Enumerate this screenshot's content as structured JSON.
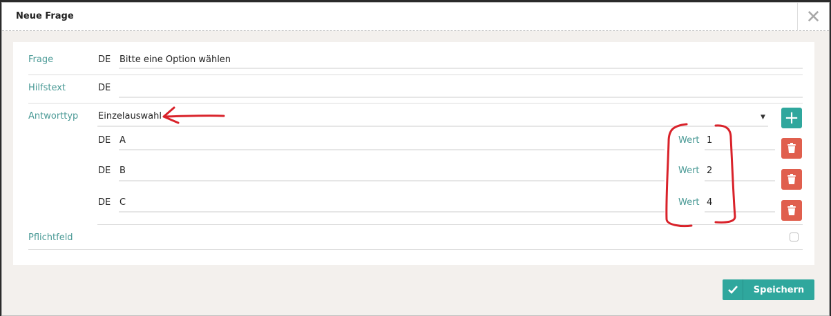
{
  "dialog": {
    "title": "Neue Frage",
    "close_glyph": "✕"
  },
  "form": {
    "frage": {
      "label": "Frage",
      "lang": "DE",
      "value": "Bitte eine Option wählen"
    },
    "hilfstext": {
      "label": "Hilfstext",
      "lang": "DE",
      "value": ""
    },
    "antworttyp": {
      "label": "Antworttyp",
      "selected": "Einzelauswahl",
      "caret": "▼",
      "add_glyph": "+"
    },
    "options": [
      {
        "lang": "DE",
        "text": "A",
        "wert_label": "Wert",
        "wert": "1"
      },
      {
        "lang": "DE",
        "text": "B",
        "wert_label": "Wert",
        "wert": "2"
      },
      {
        "lang": "DE",
        "text": "C",
        "wert_label": "Wert",
        "wert": "4"
      }
    ],
    "pflichtfeld": {
      "label": "Pflichtfeld",
      "checked": false
    }
  },
  "footer": {
    "save_label": "Speichern",
    "save_icon": "check-icon"
  },
  "colors": {
    "accent": "#2fa79d",
    "label": "#4a9a96",
    "danger": "#e05f4e",
    "annotation": "#d9222a"
  }
}
